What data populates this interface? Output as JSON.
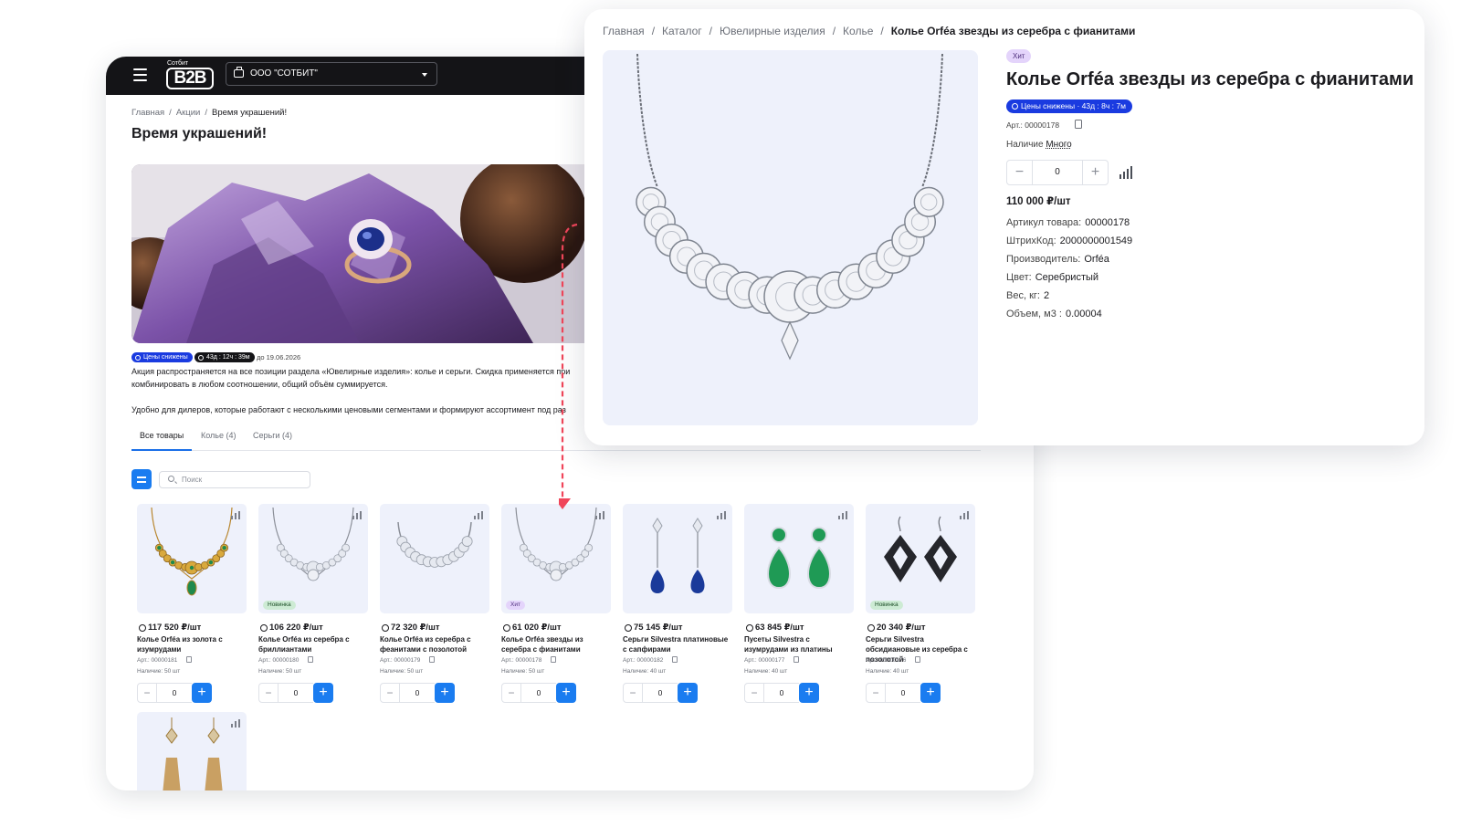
{
  "main": {
    "logo_small": "Сотбит",
    "logo_big": "B2B",
    "company": "ООО \"СОТБИТ\"",
    "breadcrumbs": [
      "Главная",
      "Акции",
      "Время украшений!"
    ],
    "title": "Время украшений!",
    "badge_sale": "Цены снижены",
    "badge_timer": "43д : 12ч : 39м",
    "until": "до 19.06.2026",
    "desc1_line1": "Акция распространяется на все позиции раздела «Ювелирные изделия»: колье и серьги. Скидка применяется при",
    "desc1_line2": "комбинировать в любом соотношении, общий объём суммируется.",
    "desc2": "Удобно для дилеров, которые работают с несколькими ценовыми сегментами и формируют ассортимент под раз",
    "tabs": [
      "Все товары",
      "Колье (4)",
      "Серьги (4)"
    ],
    "search_placeholder": "Поиск",
    "products": [
      {
        "price": "117 520 ₽/шт",
        "name": "Колье Orféa из золота с изумрудами",
        "art": "Арт.: 00000181",
        "stock": "Наличие: 50 шт",
        "qty": "0",
        "tag": ""
      },
      {
        "price": "106 220 ₽/шт",
        "name": "Колье Orféa из серебра с бриллиантами",
        "art": "Арт.: 00000180",
        "stock": "Наличие: 50 шт",
        "qty": "0",
        "tag": "Новинка"
      },
      {
        "price": "72 320 ₽/шт",
        "name": "Колье Orféa из серебра с феанитами с позолотой",
        "art": "Арт.: 00000179",
        "stock": "Наличие: 50 шт",
        "qty": "0",
        "tag": ""
      },
      {
        "price": "61 020 ₽/шт",
        "name": "Колье Orféa звезды из серебра с фианитами",
        "art": "Арт.: 00000178",
        "stock": "Наличие: 50 шт",
        "qty": "0",
        "tag": "Хит"
      },
      {
        "price": "75 145 ₽/шт",
        "name": "Серьги Silvestra платиновые с сапфирами",
        "art": "Арт.: 00000182",
        "stock": "Наличие: 40 шт",
        "qty": "0",
        "tag": ""
      },
      {
        "price": "63 845 ₽/шт",
        "name": "Пусеты Silvestra с изумрудами из платины",
        "art": "Арт.: 00000177",
        "stock": "Наличие: 40 шт",
        "qty": "0",
        "tag": ""
      },
      {
        "price": "20 340 ₽/шт",
        "name": "Серьги Silvestra обсидиановые из серебра с позолотой",
        "art": "Арт.: 00000176",
        "stock": "Наличие: 40 шт",
        "qty": "0",
        "tag": "Новинка"
      }
    ]
  },
  "detail": {
    "breadcrumbs": [
      "Главная",
      "Каталог",
      "Ювелирные изделия",
      "Колье",
      "Колье Orféa звезды из серебра с фианитами"
    ],
    "tag": "Хит",
    "title": "Колье Orféa звезды из серебра с фианитами",
    "sale_badge": "Цены снижены · 43д : 8ч : 7м",
    "art": "Арт.: 00000178",
    "stock_label": "Наличие",
    "stock_value": "Много",
    "qty": "0",
    "price": "110 000 ₽/шт",
    "props": [
      {
        "k": "Артикул товара:",
        "v": "00000178"
      },
      {
        "k": "ШтрихКод:",
        "v": "2000000001549"
      },
      {
        "k": "Производитель:",
        "v": "Orféa"
      },
      {
        "k": "Цвет:",
        "v": "Серебристый"
      },
      {
        "k": "Вес, кг:",
        "v": "2"
      },
      {
        "k": "Объем, м3 :",
        "v": "0.00004"
      }
    ]
  },
  "colors": {
    "accent": "#1a7cf0",
    "sale": "#1a3be0",
    "arrow": "#f0455a",
    "hit": "#e4d4fb",
    "new": "#cdebd4"
  },
  "icons": [
    "menu-icon",
    "briefcase-icon",
    "chevron-down-icon",
    "filter-icon",
    "search-icon",
    "compare-icon",
    "copy-icon",
    "clock-icon",
    "plus-icon",
    "minus-icon"
  ]
}
